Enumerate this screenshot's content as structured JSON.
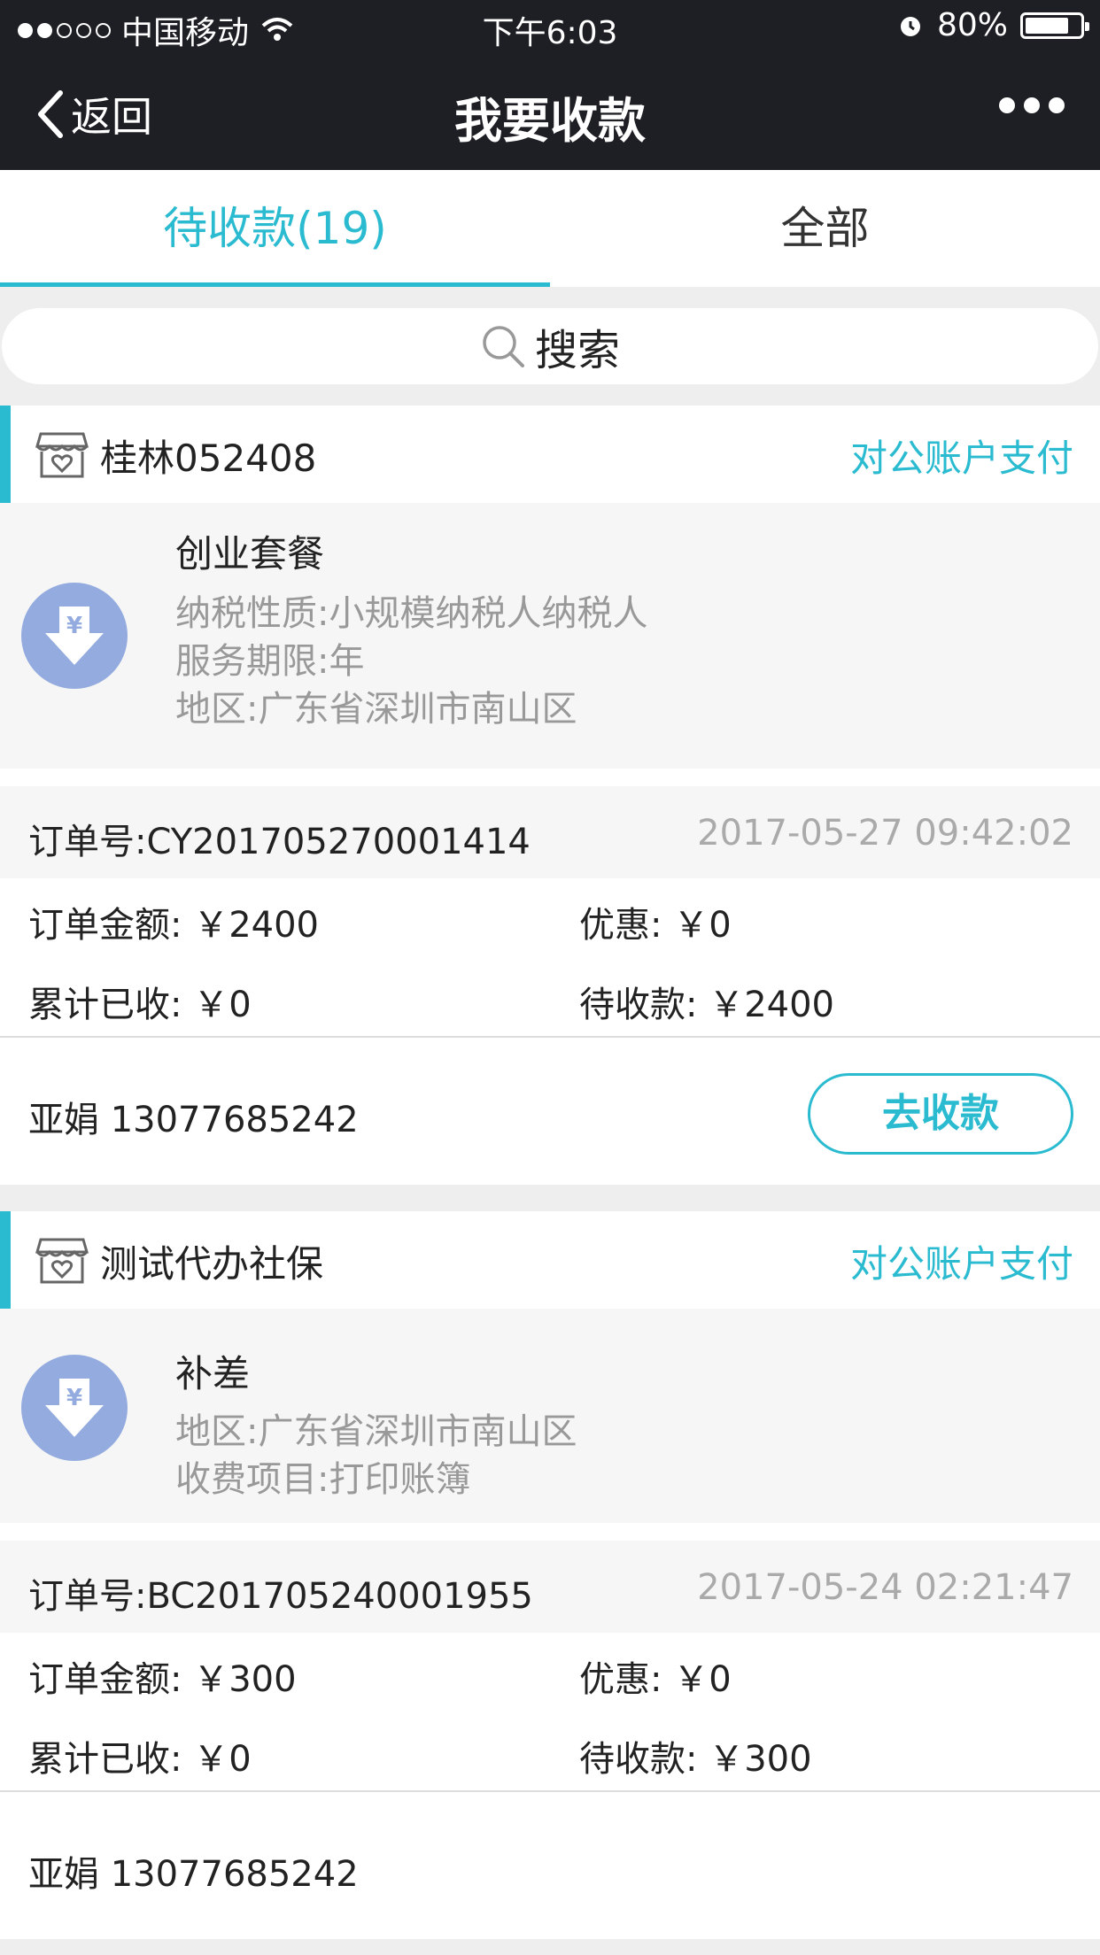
{
  "status_bar": {
    "carrier": "中国移动",
    "time": "下午6:03",
    "battery": "80%",
    "battery_level": 0.8
  },
  "nav": {
    "back_label": "返回",
    "title": "我要收款"
  },
  "tabs": [
    {
      "label": "待收款(19)",
      "active": true
    },
    {
      "label": "全部",
      "active": false
    }
  ],
  "search": {
    "label": "搜索"
  },
  "colors": {
    "accent": "#2bbbd0",
    "icon_blue": "#93abdf",
    "nav_bg": "#1e1f24"
  },
  "orders": [
    {
      "shop_name": "桂林052408",
      "pay_method": "对公账户支付",
      "product_name": "创业套餐",
      "attrs": [
        "纳税性质:小规模纳税人纳税人",
        "服务期限:年",
        "地区:广东省深圳市南山区"
      ],
      "order_no": "订单号:CY201705270001414",
      "order_time": "2017-05-27 09:42:02",
      "amount": "订单金额: ￥2400",
      "discount": "优惠: ￥0",
      "received": "累计已收: ￥0",
      "pending": "待收款: ￥2400",
      "contact": "亚娟 13077685242",
      "button": "去收款"
    },
    {
      "shop_name": "测试代办社保",
      "pay_method": "对公账户支付",
      "product_name": "补差",
      "attrs": [
        "地区:广东省深圳市南山区",
        "收费项目:打印账簿"
      ],
      "order_no": "订单号:BC201705240001955",
      "order_time": "2017-05-24 02:21:47",
      "amount": "订单金额: ￥300",
      "discount": "优惠: ￥0",
      "received": "累计已收: ￥0",
      "pending": "待收款: ￥300",
      "contact": "亚娟 13077685242"
    }
  ]
}
